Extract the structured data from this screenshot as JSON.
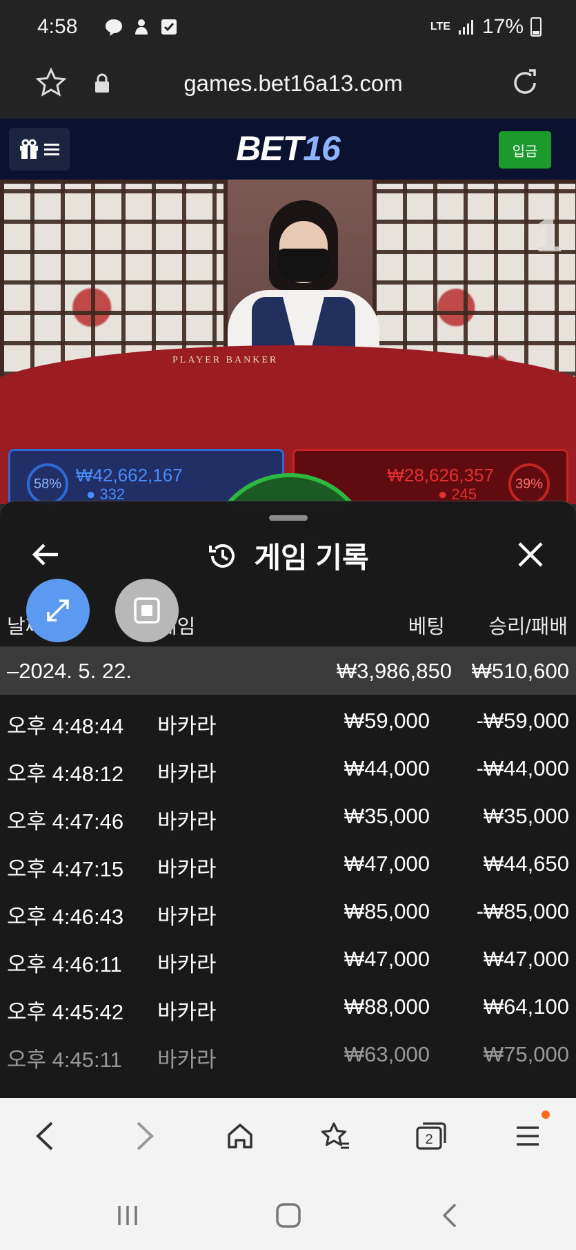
{
  "status_bar": {
    "time": "4:58",
    "network": "LTE",
    "battery": "17%"
  },
  "browser": {
    "url": "games.bet16a13.com"
  },
  "site": {
    "logo_part1": "BET",
    "logo_part2": "16",
    "deposit_label": "입금"
  },
  "video": {
    "table_label": "PLAYER    BANKER",
    "round_indicator": "1",
    "player": {
      "percent": "58%",
      "amount": "₩42,662,167",
      "count": "332"
    },
    "banker": {
      "percent": "39%",
      "amount": "₩28,626,357",
      "count": "245"
    }
  },
  "modal": {
    "title": "게임 기록",
    "columns": {
      "date": "날짜",
      "game": "게임",
      "bet": "베팅",
      "result": "승리/패배"
    },
    "date_group": {
      "label": "–2024. 5. 22.",
      "bet_total": "₩3,986,850",
      "result_total": "₩510,600"
    },
    "rows": [
      {
        "time": "오후 4:48:44",
        "game": "바카라",
        "bet": "₩59,000",
        "result": "-₩59,000"
      },
      {
        "time": "오후 4:48:12",
        "game": "바카라",
        "bet": "₩44,000",
        "result": "-₩44,000"
      },
      {
        "time": "오후 4:47:46",
        "game": "바카라",
        "bet": "₩35,000",
        "result": "₩35,000"
      },
      {
        "time": "오후 4:47:15",
        "game": "바카라",
        "bet": "₩47,000",
        "result": "₩44,650"
      },
      {
        "time": "오후 4:46:43",
        "game": "바카라",
        "bet": "₩85,000",
        "result": "-₩85,000"
      },
      {
        "time": "오후 4:46:11",
        "game": "바카라",
        "bet": "₩47,000",
        "result": "₩47,000"
      },
      {
        "time": "오후 4:45:42",
        "game": "바카라",
        "bet": "₩88,000",
        "result": "₩64,100"
      },
      {
        "time": "오후 4:45:11",
        "game": "바카라",
        "bet": "₩63,000",
        "result": "₩75,000"
      }
    ]
  },
  "colors": {
    "deposit_green": "#1c9a2c",
    "player_blue": "#2c6ad6",
    "banker_red": "#c52222",
    "expand_fab": "#5b9af0",
    "menu_badge": "#ff6a1a"
  },
  "icons": {
    "status": [
      "messenger-icon",
      "app-icon",
      "check-icon",
      "signal-icon",
      "battery-icon"
    ],
    "browser": [
      "bookmark-star-icon",
      "lock-icon",
      "reload-icon"
    ],
    "nav": [
      "back-icon",
      "forward-icon",
      "home-icon",
      "bookmarks-icon",
      "tabs-icon",
      "menu-icon"
    ]
  },
  "tabs_count": "2"
}
